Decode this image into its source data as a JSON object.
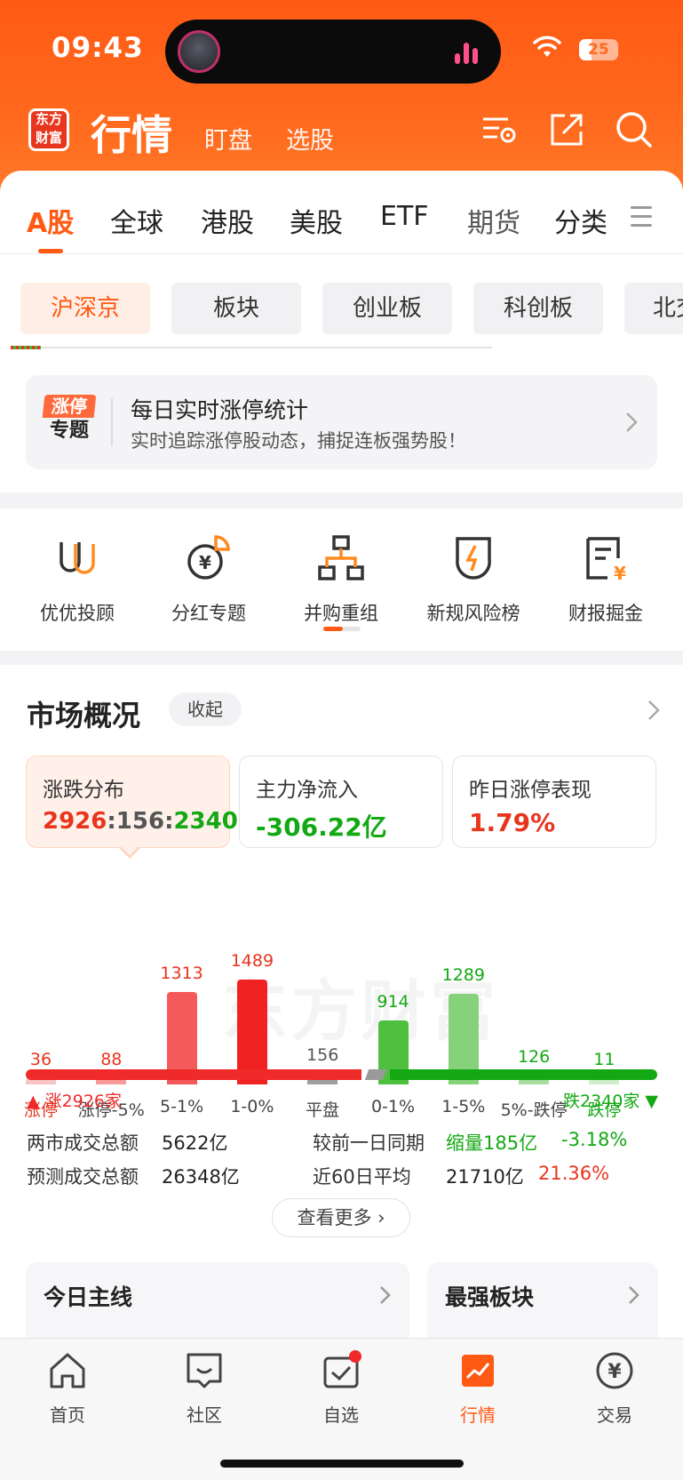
{
  "status_bar": {
    "time": "09:43",
    "battery": "25"
  },
  "header": {
    "logo_text": "东方\n财富",
    "title": "行情",
    "tabs": [
      "盯盘",
      "选股"
    ]
  },
  "market_tabs": [
    "A股",
    "全球",
    "港股",
    "美股",
    "ETF",
    "期货",
    "分类"
  ],
  "sub_tabs": [
    "沪深京",
    "板块",
    "创业板",
    "科创板",
    "北交"
  ],
  "banner": {
    "badge_top": "涨停",
    "badge_bottom": "专题",
    "title": "每日实时涨停统计",
    "subtitle": "实时追踪涨停股动态，捕捉连板强势股！"
  },
  "features": [
    "优优投顾",
    "分红专题",
    "并购重组",
    "新规风险榜",
    "财报掘金"
  ],
  "overview": {
    "title": "市场概况",
    "collapse": "收起",
    "cards": [
      {
        "label": "涨跌分布",
        "value_up": "2926",
        "value_flat": "156",
        "value_down": "2340",
        "sep": ":"
      },
      {
        "label": "主力净流入",
        "value": "-306.22亿"
      },
      {
        "label": "昨日涨停表现",
        "value": "1.79%"
      }
    ],
    "watermark": "东方财富",
    "rise_text": "涨2926家",
    "fall_text": "跌2340家",
    "rows": [
      {
        "label": "两市成交总额",
        "value": "5622亿",
        "label2": "较前一日同期",
        "change": "缩量185亿",
        "pct": "-3.18%"
      },
      {
        "label": "预测成交总额",
        "value": "26348亿",
        "label2": "近60日平均",
        "change": "21710亿",
        "pct": "21.36%"
      }
    ],
    "more": "查看更多",
    "sub_cards": [
      {
        "title": "今日主线"
      },
      {
        "title": "最强板块"
      }
    ]
  },
  "chart_data": {
    "type": "bar",
    "categories": [
      "涨停",
      "涨停-5%",
      "5-1%",
      "1-0%",
      "平盘",
      "0-1%",
      "1-5%",
      "5%-跌停",
      "跌停"
    ],
    "values": [
      36,
      88,
      1313,
      1489,
      156,
      914,
      1289,
      126,
      11
    ],
    "colors": [
      "#f8c4c4",
      "#f79a9a",
      "#f45a5a",
      "#f02222",
      "#9e9e9e",
      "#4fbf3f",
      "#86d27a",
      "#a9dd9e",
      "#cdeec8"
    ],
    "value_colors": [
      "#e8351d",
      "#e8351d",
      "#e8351d",
      "#e8351d",
      "#555555",
      "#14a814",
      "#14a814",
      "#14a814",
      "#14a814"
    ],
    "cat_colors": [
      "#e8351d",
      "#444444",
      "#444444",
      "#444444",
      "#444444",
      "#444444",
      "#444444",
      "#444444",
      "#14a814"
    ],
    "ratio": {
      "up": 2926,
      "flat": 156,
      "down": 2340
    }
  },
  "bottom_nav": [
    "首页",
    "社区",
    "自选",
    "行情",
    "交易"
  ],
  "colors": {
    "accent": "#ff5a14",
    "up": "#f02929",
    "down": "#14a814"
  }
}
